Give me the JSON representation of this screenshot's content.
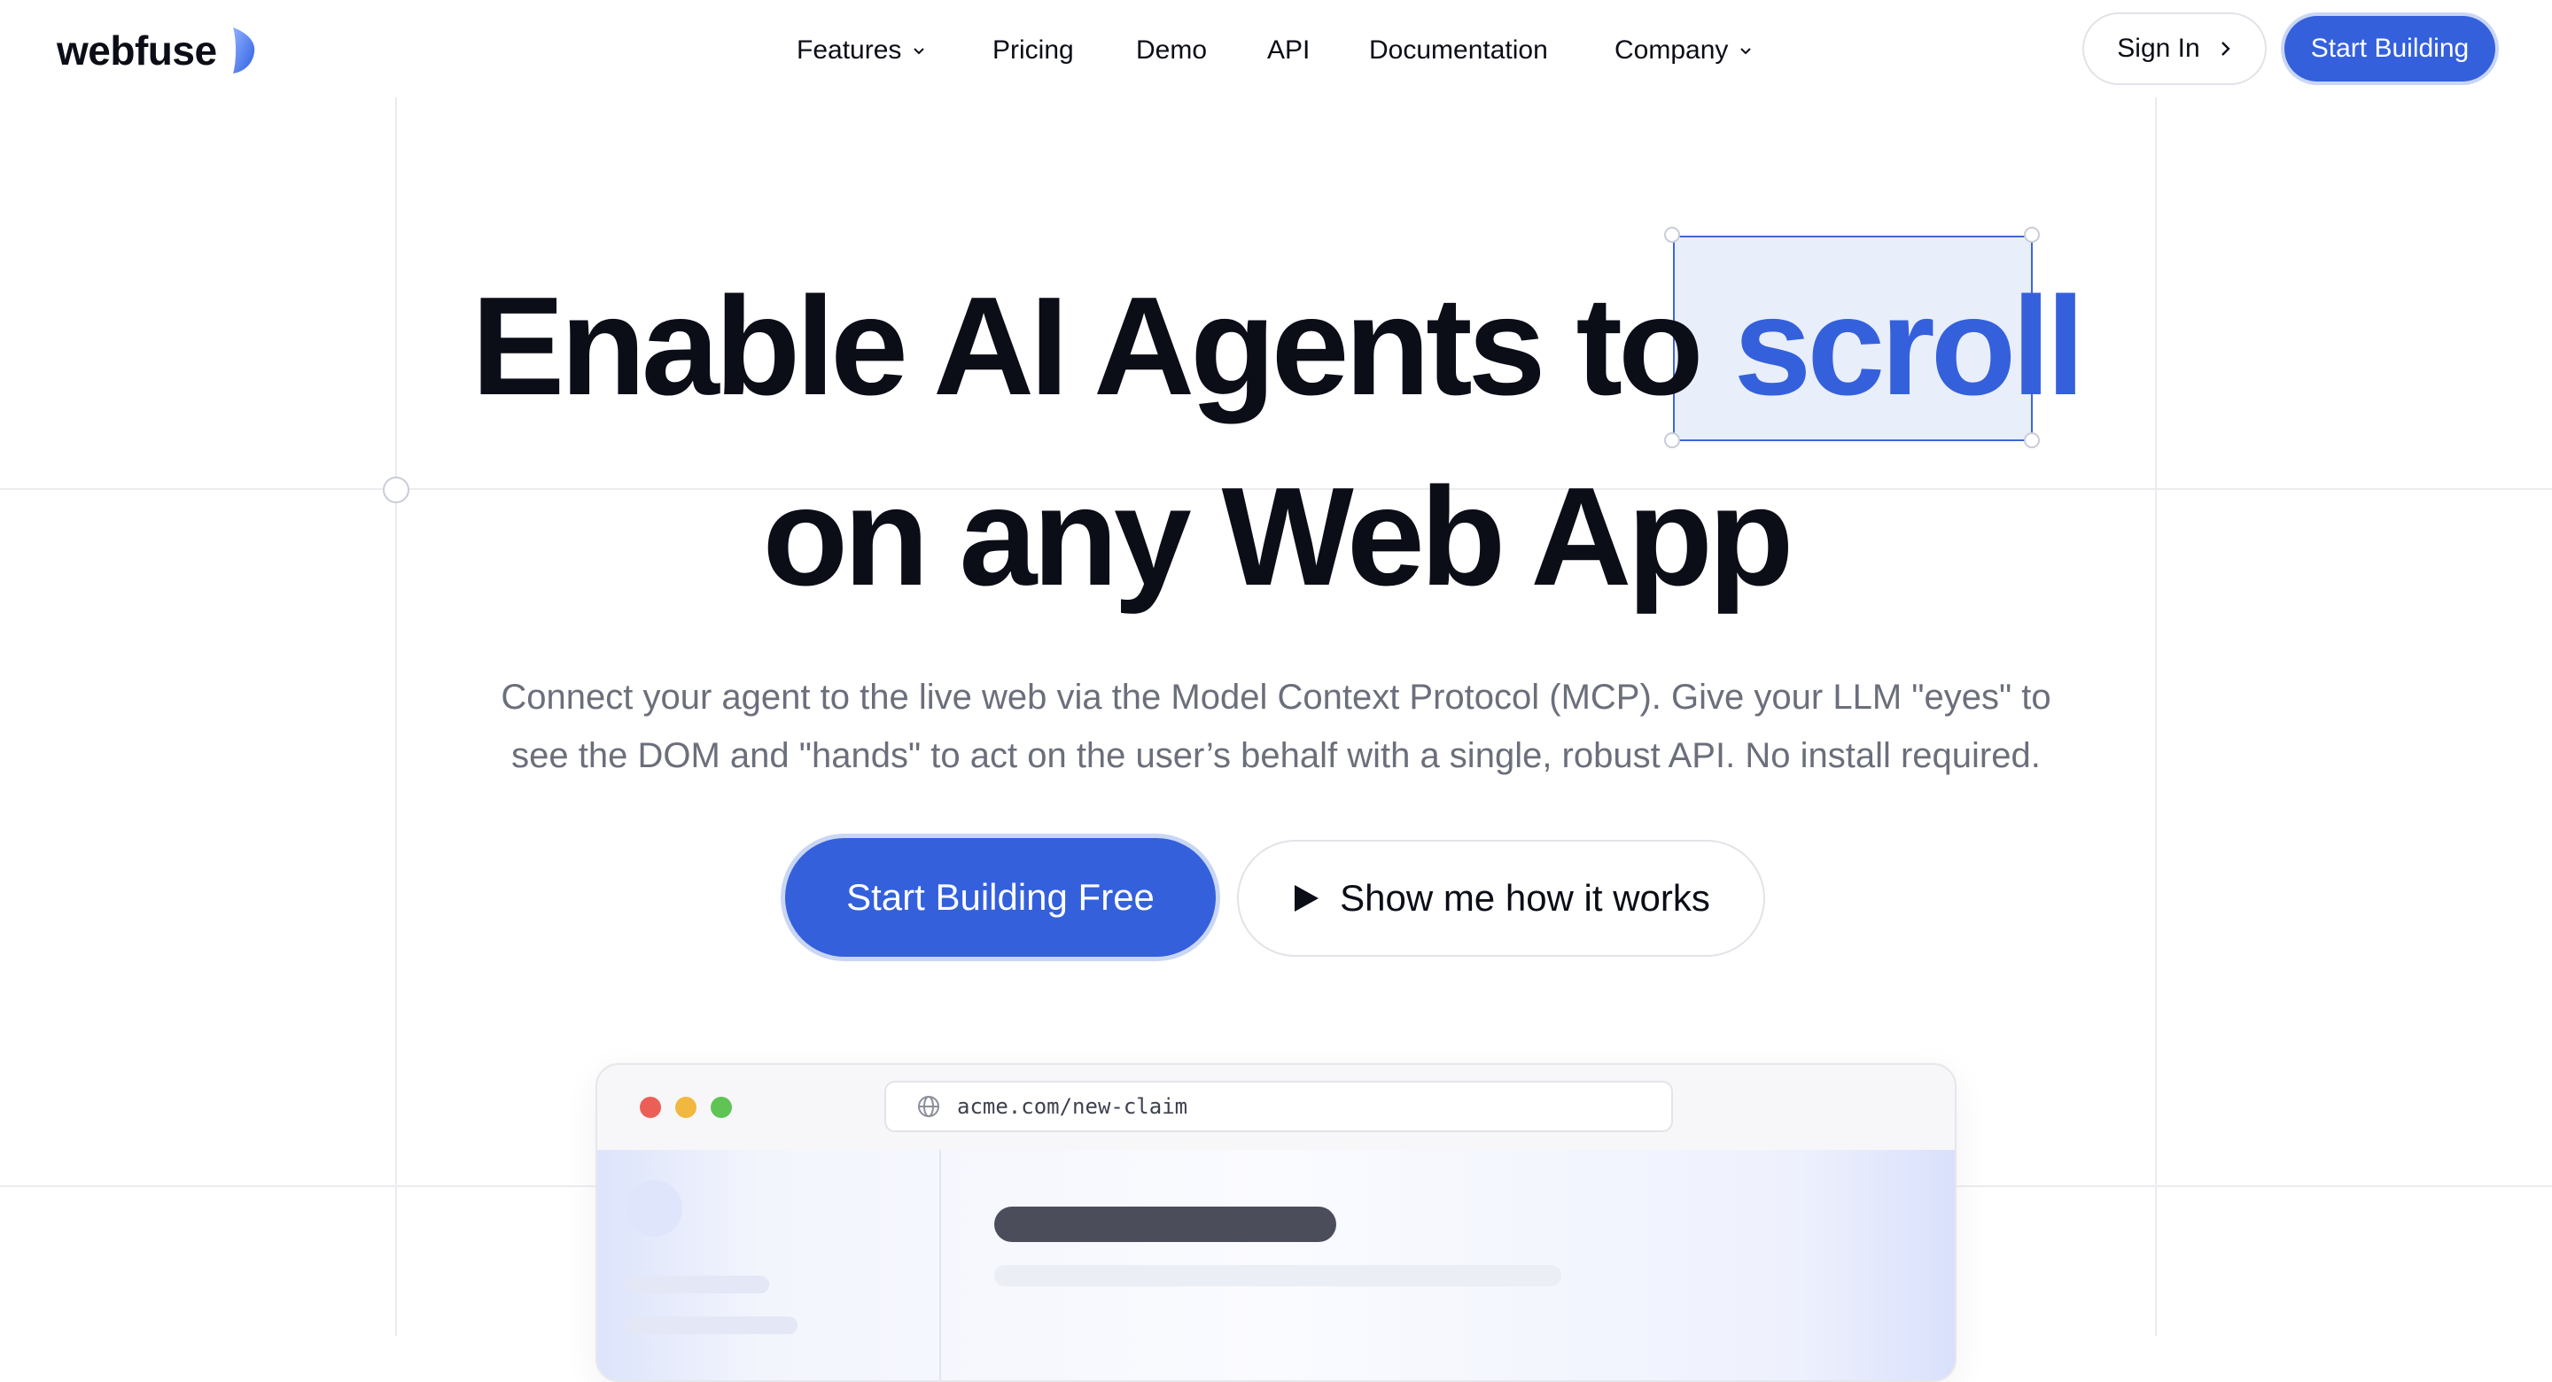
{
  "brand": {
    "name": "webfuse",
    "accent": "#3460dc"
  },
  "nav": {
    "items": [
      {
        "label": "Features",
        "dropdown": true
      },
      {
        "label": "Pricing",
        "dropdown": false
      },
      {
        "label": "Demo",
        "dropdown": false
      },
      {
        "label": "API",
        "dropdown": false
      },
      {
        "label": "Documentation",
        "dropdown": false
      },
      {
        "label": "Company",
        "dropdown": true
      }
    ],
    "sign_in": "Sign In",
    "start_building": "Start Building"
  },
  "hero": {
    "headline_part1": "Enable AI Agents to",
    "headline_highlight": "scroll",
    "headline_part2": "on any Web App",
    "subtitle_line1": "Connect your agent to the live web via the Model Context Protocol (MCP). Give your LLM \"eyes\" to",
    "subtitle_line2": "see the DOM and \"hands\" to act on the user’s behalf with a single, robust API. No install required.",
    "cta_primary": "Start Building Free",
    "cta_secondary": "Show me how it works"
  },
  "browser_mock": {
    "url": "acme.com/new-claim",
    "traffic_lights": [
      "#ec5f57",
      "#f2b73f",
      "#5fc454"
    ],
    "icons": [
      "globe-icon"
    ]
  },
  "icons": {
    "nav_dropdown": "chevron-down-icon",
    "sign_in": "chevron-right-icon",
    "cta_secondary": "play-icon",
    "logo": "logo-mark-icon"
  }
}
